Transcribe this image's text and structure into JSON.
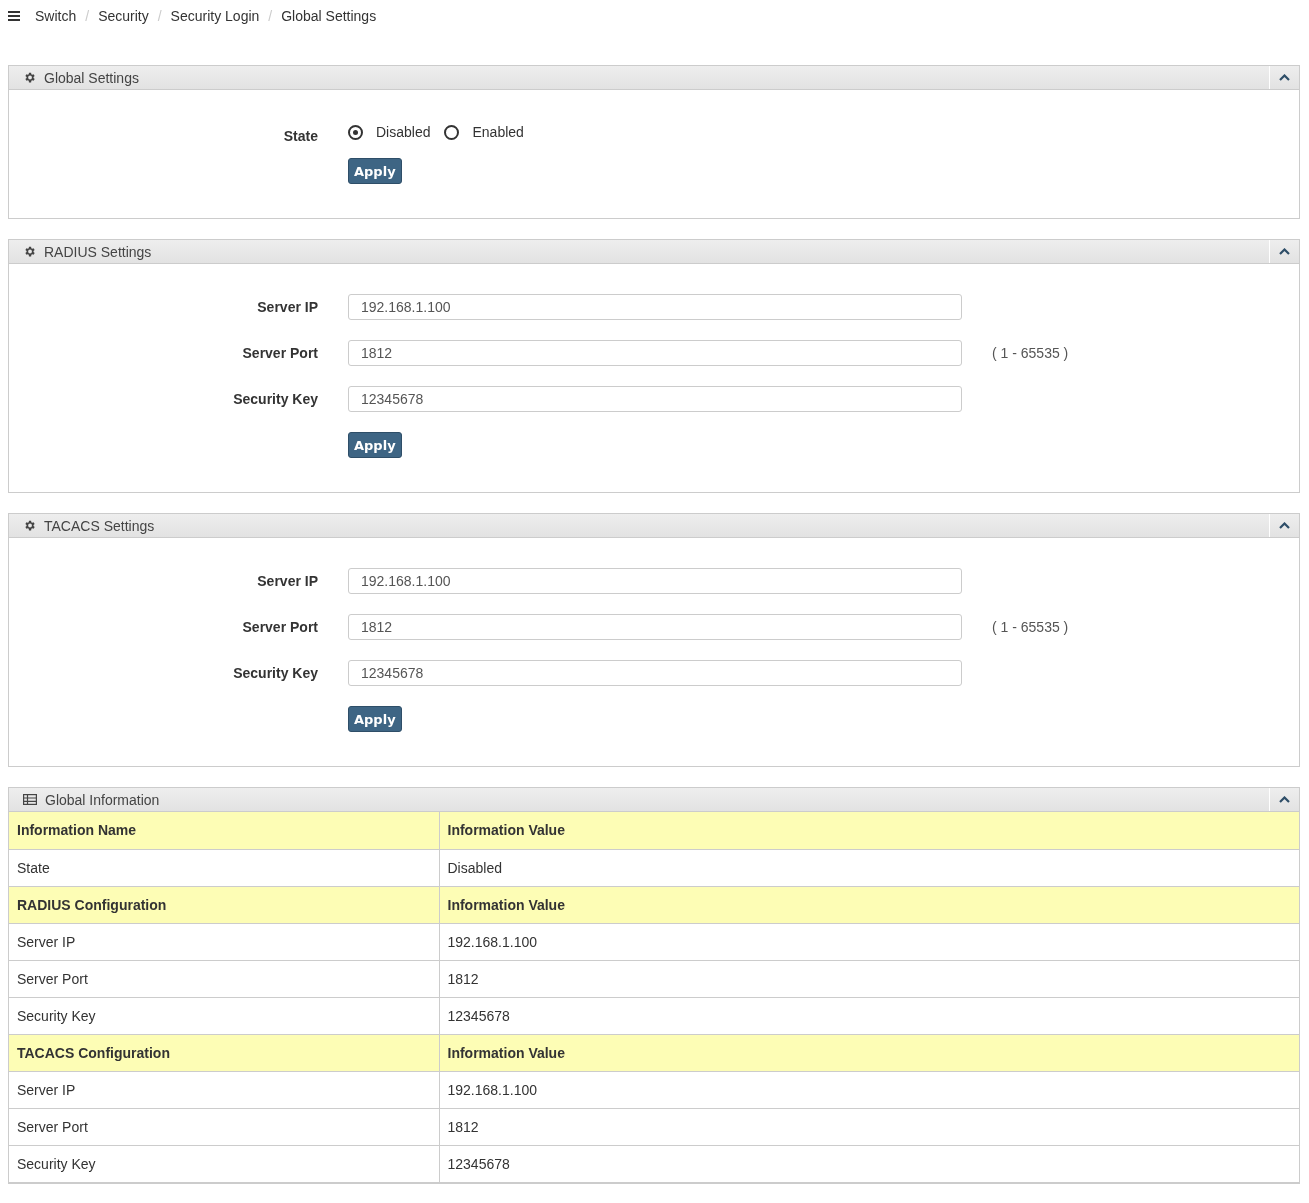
{
  "breadcrumb": {
    "separator": "/",
    "items": [
      "Switch",
      "Security",
      "Security Login",
      "Global Settings"
    ]
  },
  "global_settings": {
    "title": "Global Settings",
    "expanded": true,
    "label": "State",
    "options": [
      {
        "label": "Disabled",
        "selected": true
      },
      {
        "label": "Enabled",
        "selected": false
      }
    ],
    "button": "Apply"
  },
  "radius_settings": {
    "title": "RADIUS Settings",
    "expanded": true,
    "fields": [
      {
        "label": "Server IP",
        "value": "192.168.1.100"
      },
      {
        "label": "Server Port",
        "value": "1812",
        "hint": "( 1 - 65535 )"
      },
      {
        "label": "Security Key",
        "value": "12345678"
      }
    ],
    "button": "Apply"
  },
  "tacacs_settings": {
    "title": "TACACS Settings",
    "expanded": true,
    "fields": [
      {
        "label": "Server IP",
        "value": "192.168.1.100"
      },
      {
        "label": "Server Port",
        "value": "1812",
        "hint": "( 1 - 65535 )"
      },
      {
        "label": "Security Key",
        "value": "12345678"
      }
    ],
    "button": "Apply"
  },
  "global_information": {
    "title": "Global Information",
    "expanded": true,
    "rows": [
      {
        "kind": "header",
        "name": "Information Name",
        "value": "Information Value"
      },
      {
        "kind": "data",
        "name": "State",
        "value": "Disabled"
      },
      {
        "kind": "header",
        "name": "RADIUS Configuration",
        "value": "Information Value"
      },
      {
        "kind": "data",
        "name": "Server IP",
        "value": "192.168.1.100"
      },
      {
        "kind": "data",
        "name": "Server Port",
        "value": "1812"
      },
      {
        "kind": "data",
        "name": "Security Key",
        "value": "12345678"
      },
      {
        "kind": "header",
        "name": "TACACS Configuration",
        "value": "Information Value"
      },
      {
        "kind": "data",
        "name": "Server IP",
        "value": "192.168.1.100"
      },
      {
        "kind": "data",
        "name": "Server Port",
        "value": "1812"
      },
      {
        "kind": "data",
        "name": "Security Key",
        "value": "12345678"
      }
    ]
  }
}
